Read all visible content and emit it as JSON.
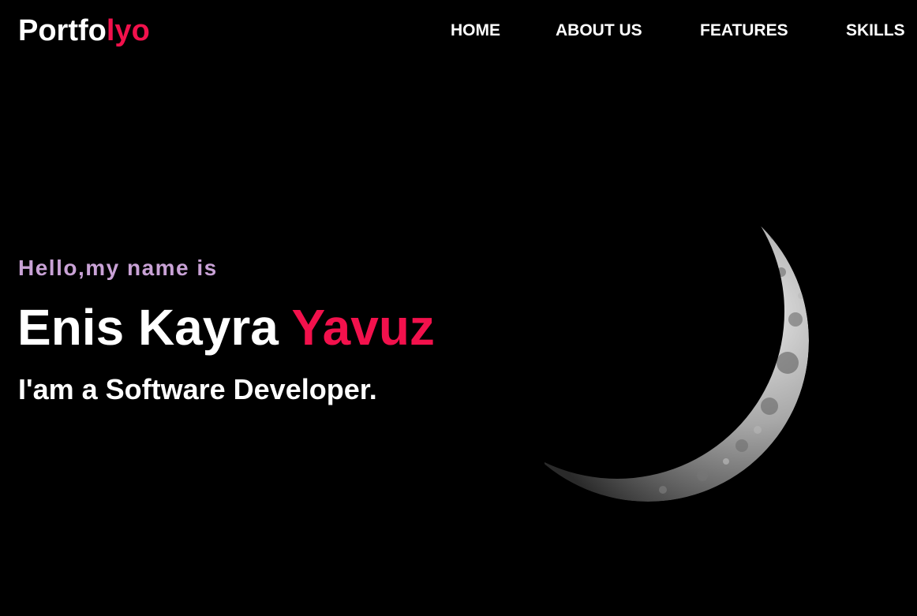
{
  "brand": {
    "logo_main": "Portfo",
    "logo_accent": "lyo"
  },
  "nav": {
    "items": [
      {
        "label": "HOME"
      },
      {
        "label": "ABOUT US"
      },
      {
        "label": "FEATURES"
      },
      {
        "label": "SKILLS"
      }
    ]
  },
  "hero": {
    "greeting": "Hello,my name is",
    "first_names": "Enis Kayra",
    "last_name": "Yavuz",
    "role": "I'am a Software Developer."
  },
  "colors": {
    "background": "#000000",
    "accent": "#f2114c",
    "greeting": "#c9a2d6",
    "text": "#ffffff"
  },
  "icons": {
    "hero_image": "crescent-moon"
  }
}
